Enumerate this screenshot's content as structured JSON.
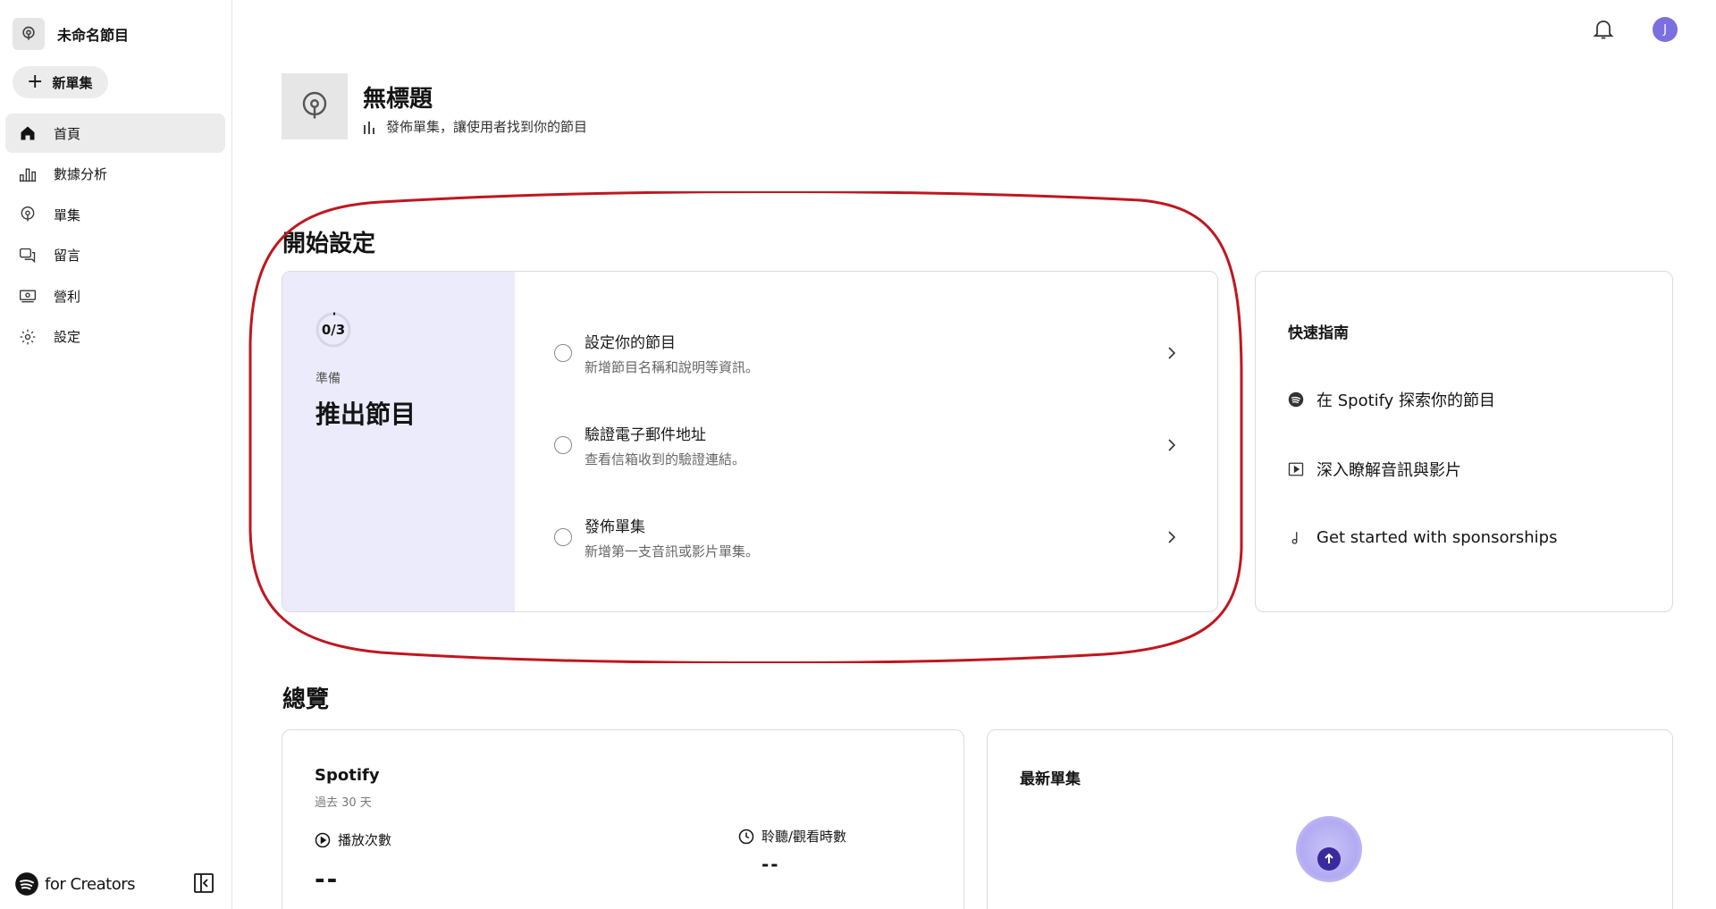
{
  "sidebar": {
    "show_title": "未命名節目",
    "new_episode_label": "新單集",
    "items": [
      {
        "label": "首頁",
        "icon": "home-icon",
        "active": true
      },
      {
        "label": "數據分析",
        "icon": "analytics-icon"
      },
      {
        "label": "單集",
        "icon": "podcast-icon"
      },
      {
        "label": "留言",
        "icon": "comments-icon"
      },
      {
        "label": "營利",
        "icon": "monetization-icon"
      },
      {
        "label": "設定",
        "icon": "gear-icon"
      }
    ],
    "brand": "for Creators"
  },
  "topbar": {
    "avatar_initial": "J"
  },
  "header": {
    "title": "無標題",
    "subtitle": "發佈單集，讓使用者找到你的節目"
  },
  "setup": {
    "section_title": "開始設定",
    "progress": "0/3",
    "progress_fraction": 0,
    "status_label": "準備",
    "goal": "推出節目",
    "tasks": [
      {
        "title": "設定你的節目",
        "desc": "新增節目名稱和說明等資訊。"
      },
      {
        "title": "驗證電子郵件地址",
        "desc": "查看信箱收到的驗證連結。"
      },
      {
        "title": "發佈單集",
        "desc": "新增第一支音訊或影片單集。"
      }
    ]
  },
  "guide": {
    "title": "快速指南",
    "items": [
      {
        "label": "在 Spotify 探索你的節目",
        "icon": "spotify-icon"
      },
      {
        "label": "深入瞭解音訊與影片",
        "icon": "play-box-icon"
      },
      {
        "label": "Get started with sponsorships",
        "icon": "music-note-icon"
      }
    ]
  },
  "overview": {
    "section_title": "總覽",
    "spotify": {
      "title": "Spotify",
      "period": "過去 30 天",
      "plays_label": "播放次數",
      "plays_value": "--",
      "listen_time_label": "聆聽/觀看時數",
      "listen_time_value": "--"
    },
    "latest": {
      "title": "最新單集"
    }
  },
  "colors": {
    "accent_purple": "#7c6fe0",
    "setup_pane_bg": "#ebebfc",
    "highlight_red": "#c0161f"
  }
}
